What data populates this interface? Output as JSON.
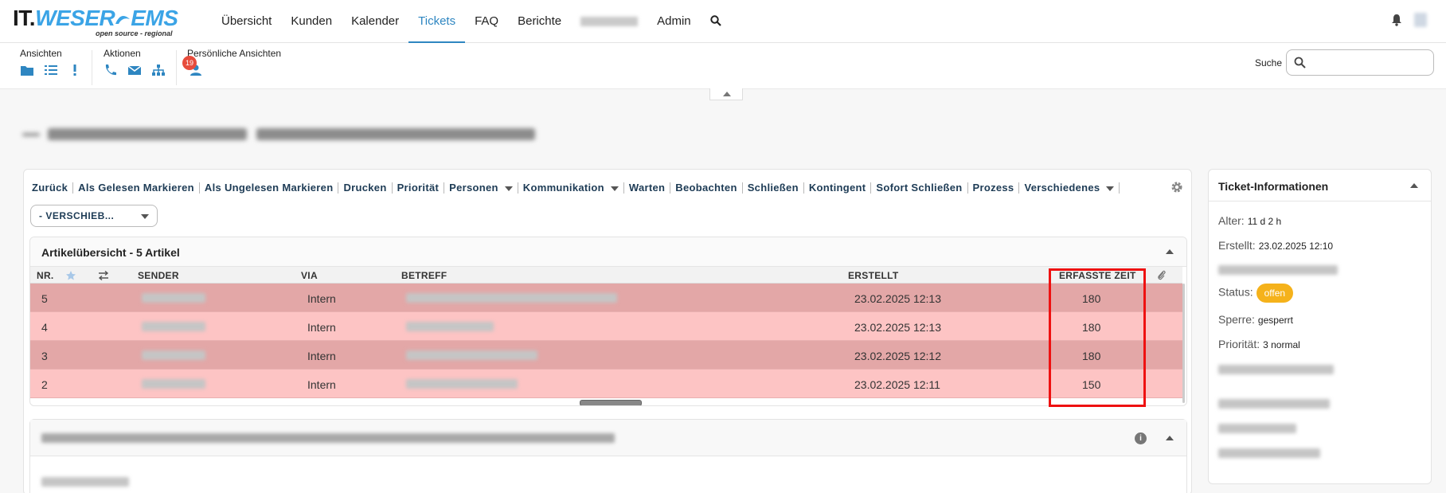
{
  "brand": {
    "logo_main": "IT.",
    "logo_accent": "WESER",
    "logo_end": "EMS",
    "tagline": "open source - regional"
  },
  "nav": {
    "items": [
      {
        "label": "Übersicht"
      },
      {
        "label": "Kunden"
      },
      {
        "label": "Kalender"
      },
      {
        "label": "Tickets"
      },
      {
        "label": "FAQ"
      },
      {
        "label": "Berichte"
      },
      {
        "label": ""
      },
      {
        "label": "Admin"
      }
    ]
  },
  "toolbar": {
    "views_title": "Ansichten",
    "actions_title": "Aktionen",
    "personal_title": "Persönliche Ansichten",
    "personal_badge": "19",
    "search_label": "Suche",
    "search_placeholder": ""
  },
  "actions": {
    "items": [
      "Zurück",
      "Als Gelesen Markieren",
      "Als Ungelesen Markieren",
      "Drucken",
      "Priorität",
      "Personen",
      "Kommunikation",
      "Warten",
      "Beobachten",
      "Schließen",
      "Kontingent",
      "Sofort Schließen",
      "Prozess",
      "Verschiedenes"
    ],
    "move_dropdown": "- VERSCHIEB..."
  },
  "articles": {
    "title": "Artikelübersicht - 5 Artikel",
    "columns": {
      "nr": "NR.",
      "sender": "SENDER",
      "via": "VIA",
      "subject": "BETREFF",
      "created": "ERSTELLT",
      "time": "ERFASSTE ZEIT"
    },
    "rows": [
      {
        "nr": "5",
        "via": "Intern",
        "created": "23.02.2025 12:13",
        "time": "180"
      },
      {
        "nr": "4",
        "via": "Intern",
        "created": "23.02.2025 12:13",
        "time": "180"
      },
      {
        "nr": "3",
        "via": "Intern",
        "created": "23.02.2025 12:12",
        "time": "180"
      },
      {
        "nr": "2",
        "via": "Intern",
        "created": "23.02.2025 12:11",
        "time": "150"
      }
    ]
  },
  "ticket_info": {
    "title": "Ticket-Informationen",
    "age_label": "Alter:",
    "age_value": "11 d 2 h",
    "created_label": "Erstellt:",
    "created_value": "23.02.2025 12:10",
    "status_label": "Status:",
    "status_value": "offen",
    "lock_label": "Sperre:",
    "lock_value": "gesperrt",
    "priority_label": "Priorität:",
    "priority_value": "3 normal"
  },
  "colors": {
    "accent": "#2e86c1",
    "row_dark": "#e3a7a7",
    "row_light": "#fdc4c4",
    "status": "#f5b21b",
    "badge": "#e74c3c",
    "highlight": "#ee1111"
  }
}
